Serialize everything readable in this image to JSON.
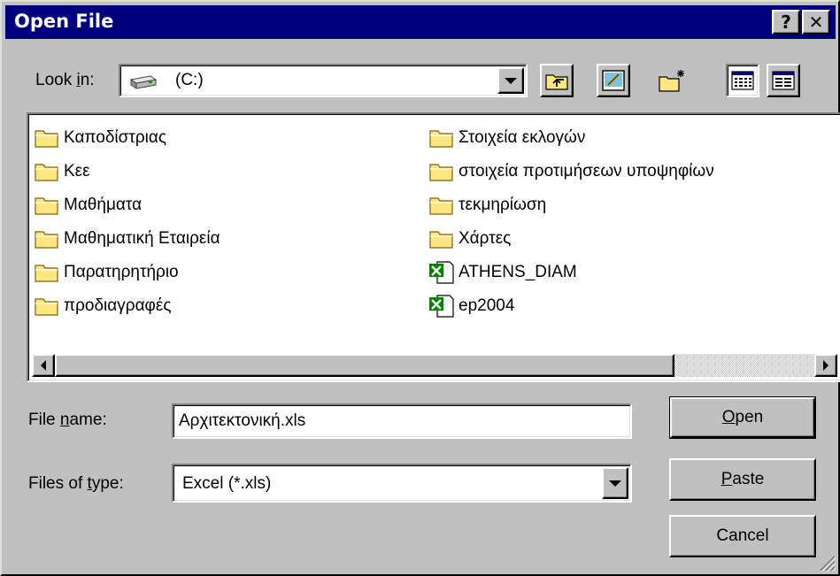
{
  "title": "Open File",
  "titlebar_buttons": {
    "help": "?",
    "close": "✕"
  },
  "look_in": {
    "label_pre": "Look ",
    "label_hot": "i",
    "label_post": "n:",
    "value": "(C:)"
  },
  "toolbar": {
    "up_folder_icon": "up-one-level-icon",
    "desktop_icon": "desktop-icon",
    "new_folder_icon": "new-folder-icon",
    "list_icon": "list-view-icon",
    "details_icon": "details-view-icon"
  },
  "files": [
    {
      "name": "Καποδίστριας",
      "type": "folder"
    },
    {
      "name": "Κεε",
      "type": "folder"
    },
    {
      "name": "Μαθήματα",
      "type": "folder"
    },
    {
      "name": "Μαθηματική Εταιρεία",
      "type": "folder"
    },
    {
      "name": "Παρατηρητήριο",
      "type": "folder"
    },
    {
      "name": "προδιαγραφές",
      "type": "folder"
    },
    {
      "name": "Στοιχεία εκλογών",
      "type": "folder"
    },
    {
      "name": "στοιχεία προτιμήσεων υποψηφίων",
      "type": "folder"
    },
    {
      "name": "τεκμηρίωση",
      "type": "folder"
    },
    {
      "name": "Χάρτες",
      "type": "folder"
    },
    {
      "name": "ATHENS_DIAM",
      "type": "excel"
    },
    {
      "name": "ep2004",
      "type": "excel"
    }
  ],
  "file_name": {
    "label_pre": "File ",
    "label_hot": "n",
    "label_post": "ame:",
    "value": "Αρχιτεκτονική.xls"
  },
  "files_of_type": {
    "label_pre": "Files of ",
    "label_hot": "t",
    "label_post": "ype:",
    "value": "Excel (*.xls)"
  },
  "buttons": {
    "open": {
      "hot": "O",
      "rest": "pen"
    },
    "paste": {
      "hot": "P",
      "rest": "aste"
    },
    "cancel": "Cancel"
  },
  "colors": {
    "title_bg": "#000080",
    "face": "#c0c0c0",
    "folder": "#ffe680"
  }
}
